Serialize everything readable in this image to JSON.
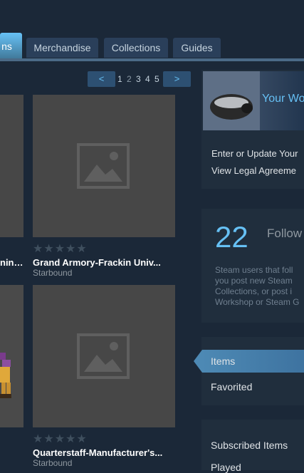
{
  "tabs": [
    {
      "label": "ns"
    },
    {
      "label": "Merchandise"
    },
    {
      "label": "Collections"
    },
    {
      "label": "Guides"
    }
  ],
  "pager": {
    "prev": "<",
    "next": ">",
    "pages": [
      "1",
      "2",
      "3",
      "4",
      "5"
    ],
    "current": "2"
  },
  "items": [
    {
      "title": "ning...",
      "subtitle": ""
    },
    {
      "title": "Grand Armory-Frackin Univ...",
      "subtitle": "Starbound",
      "rating": 0
    },
    {
      "title": "",
      "subtitle": ""
    },
    {
      "title": "Quarterstaff-Manufacturer's...",
      "subtitle": "Starbound",
      "rating": 0
    }
  ],
  "sidebar": {
    "banner_title": "Your Wo",
    "links": [
      "Enter or Update Your",
      "View Legal Agreeme"
    ],
    "followers_count": "22",
    "followers_label": "Follow",
    "description_lines": [
      "Steam users that foll",
      "you post new Steam",
      "Collections, or post i",
      "Workshop or Steam G"
    ],
    "nav": [
      "Items",
      "Favorited",
      "Subscribed Items",
      "Played"
    ]
  },
  "colors": {
    "background": "#1b2838",
    "accent": "#66c0f4",
    "tile": "#474747"
  }
}
